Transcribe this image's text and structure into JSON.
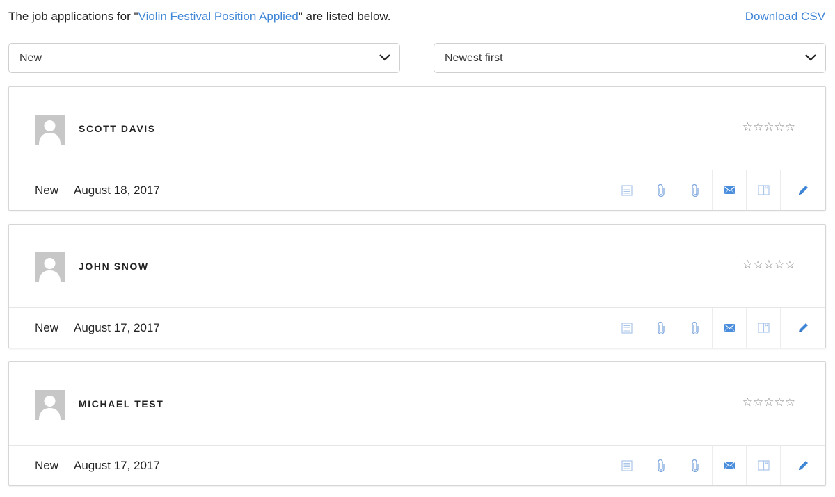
{
  "header": {
    "intro_prefix": "The job applications for \"",
    "position_link": "Violin Festival Position Applied",
    "intro_suffix": "\" are listed below.",
    "download_csv": "Download CSV"
  },
  "filters": {
    "status_selected": "New",
    "sort_selected": "Newest first"
  },
  "colors": {
    "accent": "#3f86d6",
    "icon_muted": "#a9c5ea",
    "avatar_bg": "#c7c7c7"
  },
  "applications": [
    {
      "name": "SCOTT DAVIS",
      "rating": 0,
      "rating_max": 5,
      "stars": "☆☆☆☆☆",
      "status": "New",
      "date": "August 18, 2017"
    },
    {
      "name": "JOHN SNOW",
      "rating": 0,
      "rating_max": 5,
      "stars": "☆☆☆☆☆",
      "status": "New",
      "date": "August 17, 2017"
    },
    {
      "name": "MICHAEL TEST",
      "rating": 0,
      "rating_max": 5,
      "stars": "☆☆☆☆☆",
      "status": "New",
      "date": "August 17, 2017"
    }
  ],
  "action_icons": [
    "list-icon",
    "paperclip-icon",
    "paperclip-icon",
    "envelope-icon",
    "book-icon",
    "pencil-icon"
  ]
}
